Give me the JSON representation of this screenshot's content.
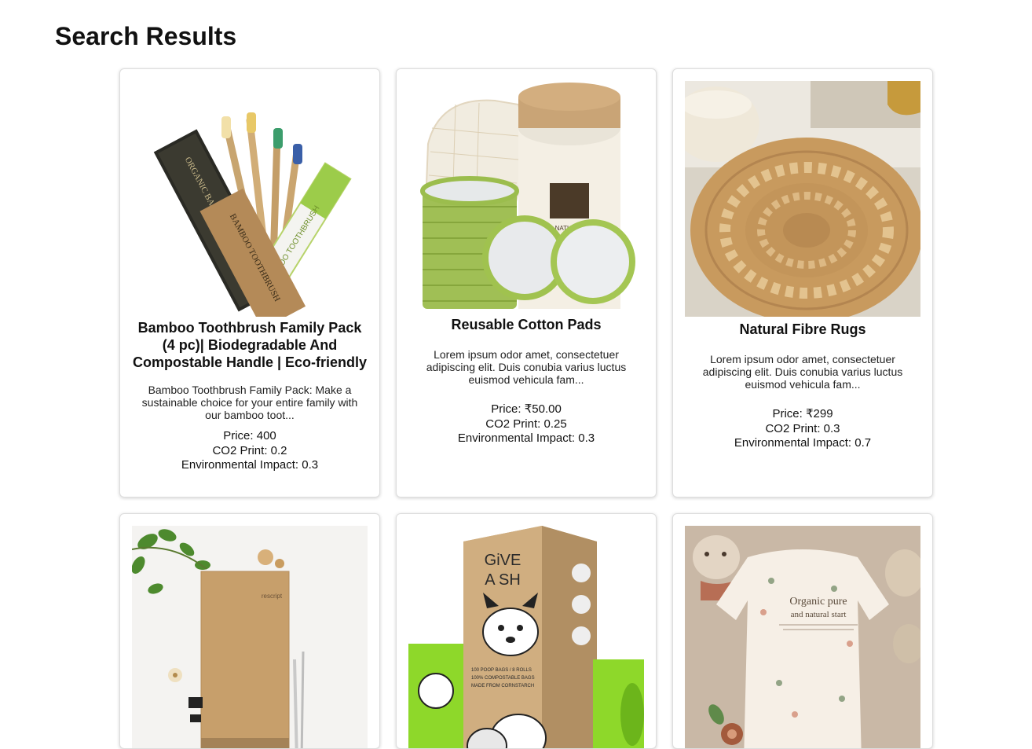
{
  "page": {
    "title": "Search Results"
  },
  "products": [
    {
      "name": "Bamboo Toothbrush Family Pack (4 pc)| Biodegradable And Compostable Handle | Eco-friendly",
      "description": "Bamboo Toothbrush Family Pack: Make a sustainable choice for your entire family with our bamboo toot...",
      "price": "Price: 400",
      "co2": "CO2 Print: 0.2",
      "impact": "Environmental Impact: 0.3",
      "image_icon": "bamboo-toothbrush-image"
    },
    {
      "name": "Reusable Cotton Pads",
      "description": "Lorem ipsum odor amet, consectetuer adipiscing elit. Duis conubia varius luctus euismod vehicula fam...",
      "price": "Price: ₹50.00",
      "co2": "CO2 Print: 0.25",
      "impact": "Environmental Impact: 0.3",
      "image_icon": "cotton-pads-image"
    },
    {
      "name": "Natural Fibre Rugs",
      "description": "Lorem ipsum odor amet, consectetuer adipiscing elit. Duis conubia varius luctus euismod vehicula fam...",
      "price": "Price: ₹299",
      "co2": "CO2 Print: 0.3",
      "impact": "Environmental Impact: 0.7",
      "image_icon": "jute-rug-image"
    },
    {
      "image_icon": "kraft-notebook-image",
      "image_text": "rescript"
    },
    {
      "image_icon": "dog-poop-bags-image",
      "image_text": [
        "GiVE",
        "A SH",
        "100 POOP BAGS / 8 ROLLS",
        "100% COMPOSTABLE BAGS",
        "MADE FROM CORNSTARCH"
      ]
    },
    {
      "image_icon": "organic-baby-onesie-image",
      "image_text": [
        "Organic pure",
        "and natural start"
      ]
    }
  ],
  "colors": {
    "card_border": "#dddddd",
    "text": "#111111",
    "bamboo_green": "#8db23a",
    "kraft": "#c9a172"
  }
}
